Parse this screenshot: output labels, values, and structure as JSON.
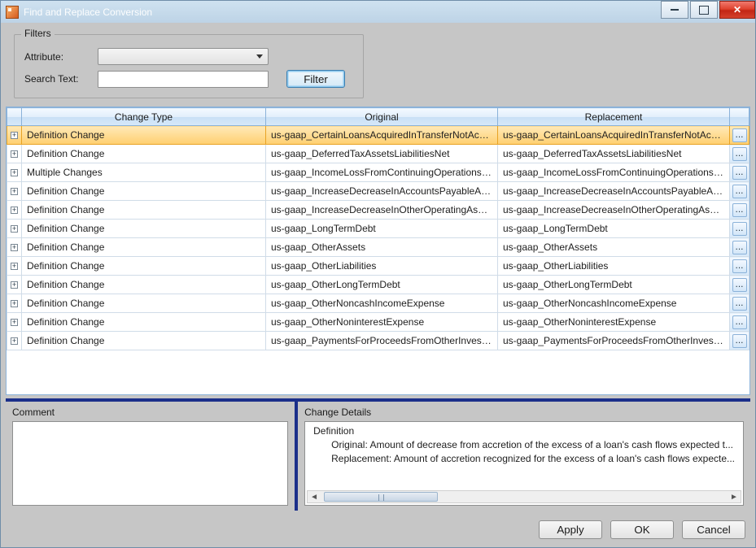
{
  "window": {
    "title": "Find and Replace Conversion"
  },
  "filters": {
    "group_label": "Filters",
    "attribute_label": "Attribute:",
    "attribute_value": "",
    "search_label": "Search Text:",
    "search_value": "",
    "filter_btn": "Filter"
  },
  "grid": {
    "columns": {
      "change_type": "Change Type",
      "original": "Original",
      "replacement": "Replacement"
    },
    "rows": [
      {
        "selected": true,
        "change_type": "Definition Change",
        "original": "us-gaap_CertainLoansAcquiredInTransferNotAccounte...",
        "replacement": "us-gaap_CertainLoansAcquiredInTransferNotAccounte..."
      },
      {
        "selected": false,
        "change_type": "Definition Change",
        "original": "us-gaap_DeferredTaxAssetsLiabilitiesNet",
        "replacement": "us-gaap_DeferredTaxAssetsLiabilitiesNet"
      },
      {
        "selected": false,
        "change_type": "Multiple Changes",
        "original": "us-gaap_IncomeLossFromContinuingOperationsBefor...",
        "replacement": "us-gaap_IncomeLossFromContinuingOperationsBefor..."
      },
      {
        "selected": false,
        "change_type": "Definition Change",
        "original": "us-gaap_IncreaseDecreaseInAccountsPayableAndOthe...",
        "replacement": "us-gaap_IncreaseDecreaseInAccountsPayableAndOthe..."
      },
      {
        "selected": false,
        "change_type": "Definition Change",
        "original": "us-gaap_IncreaseDecreaseInOtherOperatingAssets",
        "replacement": "us-gaap_IncreaseDecreaseInOtherOperatingAssets"
      },
      {
        "selected": false,
        "change_type": "Definition Change",
        "original": "us-gaap_LongTermDebt",
        "replacement": "us-gaap_LongTermDebt"
      },
      {
        "selected": false,
        "change_type": "Definition Change",
        "original": "us-gaap_OtherAssets",
        "replacement": "us-gaap_OtherAssets"
      },
      {
        "selected": false,
        "change_type": "Definition Change",
        "original": "us-gaap_OtherLiabilities",
        "replacement": "us-gaap_OtherLiabilities"
      },
      {
        "selected": false,
        "change_type": "Definition Change",
        "original": "us-gaap_OtherLongTermDebt",
        "replacement": "us-gaap_OtherLongTermDebt"
      },
      {
        "selected": false,
        "change_type": "Definition Change",
        "original": "us-gaap_OtherNoncashIncomeExpense",
        "replacement": "us-gaap_OtherNoncashIncomeExpense"
      },
      {
        "selected": false,
        "change_type": "Definition Change",
        "original": "us-gaap_OtherNoninterestExpense",
        "replacement": "us-gaap_OtherNoninterestExpense"
      },
      {
        "selected": false,
        "change_type": "Definition Change",
        "original": "us-gaap_PaymentsForProceedsFromOtherInvestingAct...",
        "replacement": "us-gaap_PaymentsForProceedsFromOtherInvestingAct..."
      }
    ],
    "ellipsis": "..."
  },
  "lower": {
    "comment_label": "Comment",
    "comment_text": "",
    "details_label": "Change Details",
    "details_header": "Definition",
    "details_original": "Original: Amount of decrease from accretion of the excess of a loan's cash flows expected t...",
    "details_replacement": "Replacement: Amount of accretion recognized for the excess of a loan's cash flows expecte..."
  },
  "footer": {
    "apply": "Apply",
    "ok": "OK",
    "cancel": "Cancel"
  }
}
